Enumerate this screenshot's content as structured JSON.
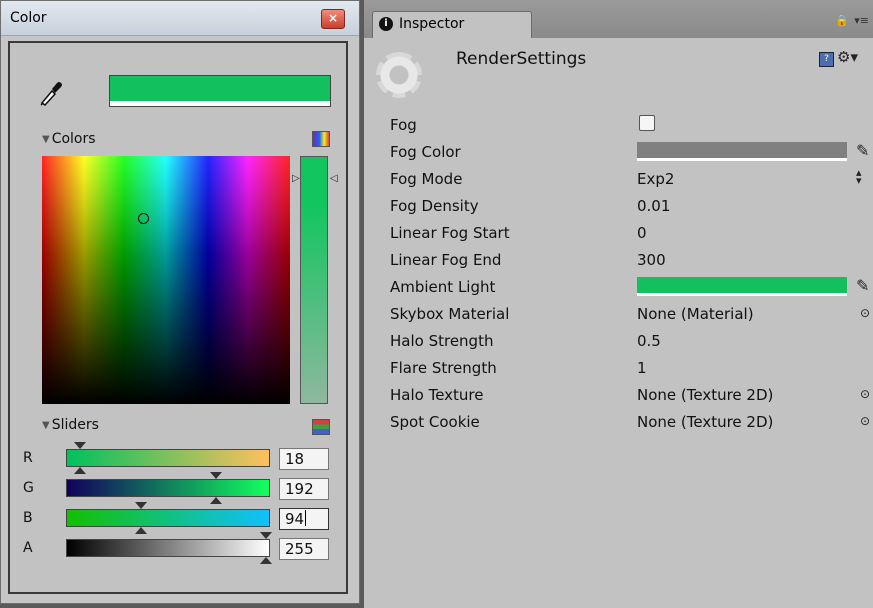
{
  "color_window": {
    "title": "Color",
    "close_label": "×",
    "current_color": "#12c05e",
    "colors_label": "Colors",
    "sliders_label": "Sliders",
    "sliders": [
      {
        "channel": "R",
        "value": "18"
      },
      {
        "channel": "G",
        "value": "192"
      },
      {
        "channel": "B",
        "value": "94"
      },
      {
        "channel": "A",
        "value": "255"
      }
    ]
  },
  "inspector": {
    "tab_label": "Inspector",
    "info_glyph": "i",
    "object_name": "RenderSettings",
    "help_glyph": "?",
    "properties": [
      {
        "label": "Fog",
        "value": ""
      },
      {
        "label": "Fog Color",
        "value": "",
        "color": "#808080"
      },
      {
        "label": "Fog Mode",
        "value": "Exp2"
      },
      {
        "label": "Fog Density",
        "value": "0.01"
      },
      {
        "label": "Linear Fog Start",
        "value": "0"
      },
      {
        "label": "Linear Fog End",
        "value": "300"
      },
      {
        "label": "Ambient Light",
        "value": "",
        "color": "#12c05e"
      },
      {
        "label": "Skybox Material",
        "value": "None (Material)"
      },
      {
        "label": "Halo Strength",
        "value": "0.5"
      },
      {
        "label": "Flare Strength",
        "value": "1"
      },
      {
        "label": "Halo Texture",
        "value": "None (Texture 2D)"
      },
      {
        "label": "Spot Cookie",
        "value": "None (Texture 2D)"
      }
    ]
  }
}
